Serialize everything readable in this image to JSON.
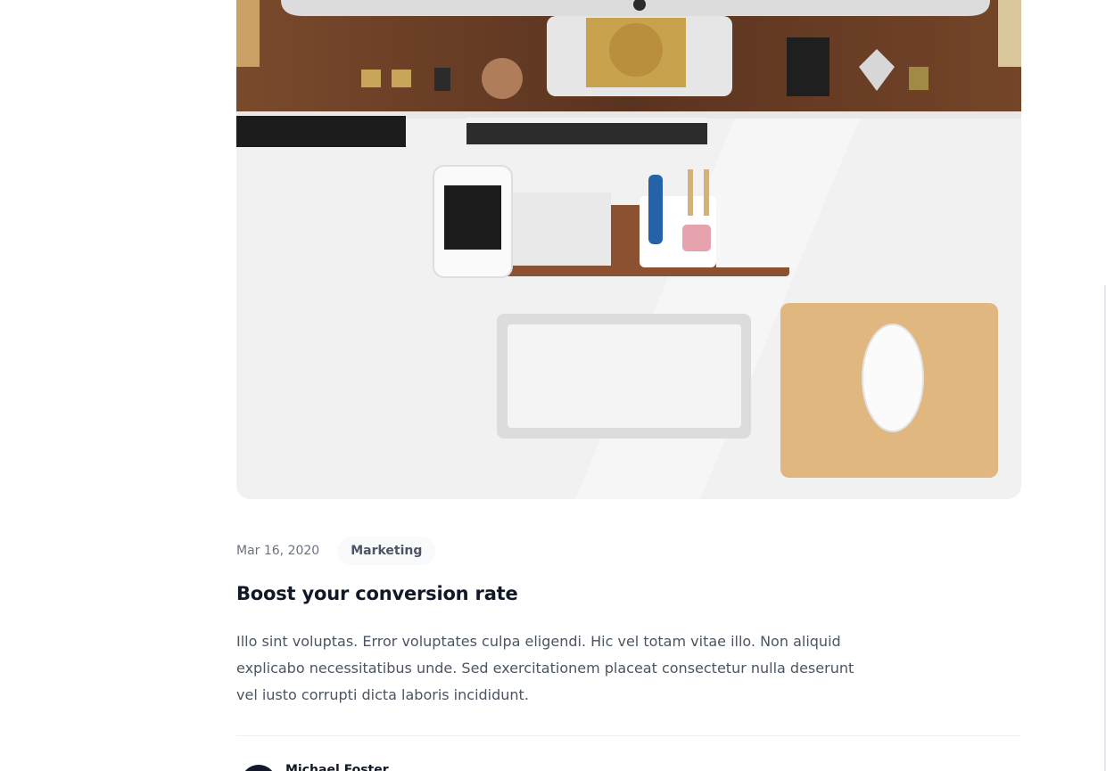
{
  "article": {
    "image_alt": "Desk workspace with keyboard, mouse and phone",
    "date": "Mar 16, 2020",
    "category": "Marketing",
    "title": "Boost your conversion rate",
    "excerpt": "Illo sint voluptas. Error voluptates culpa eligendi. Hic vel totam vitae illo. Non aliquid explicabo necessitatibus unde. Sed exercitationem placeat consectetur nulla deserunt vel iusto corrupti dicta laboris incididunt.",
    "author": {
      "name": "Michael Foster"
    }
  }
}
